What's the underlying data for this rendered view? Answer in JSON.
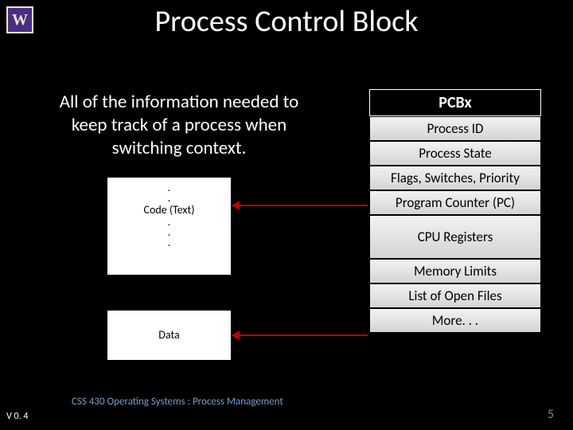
{
  "logo": "W",
  "title": "Process Control Block",
  "description": "All of the information needed to keep track of a process when switching context.",
  "memory": {
    "code": {
      "label": "Code (Text)",
      "dots_above": [
        ".",
        "."
      ],
      "dots_below": [
        ".",
        ".",
        "."
      ]
    },
    "data": {
      "label": "Data"
    }
  },
  "pcb": {
    "header": "PCBx",
    "rows": [
      {
        "label": "Process ID",
        "tall": false
      },
      {
        "label": "Process State",
        "tall": false
      },
      {
        "label": "Flags, Switches, Priority",
        "tall": false
      },
      {
        "label": "Program Counter (PC)",
        "tall": false
      },
      {
        "label": "CPU Registers",
        "tall": true
      },
      {
        "label": "Memory Limits",
        "tall": false
      },
      {
        "label": "List of Open Files",
        "tall": false
      },
      {
        "label": "More. . .",
        "tall": false
      }
    ]
  },
  "footer": {
    "version": "V 0. 4",
    "course": "CSS 430 Operating Systems : Process Management",
    "page": "5"
  }
}
